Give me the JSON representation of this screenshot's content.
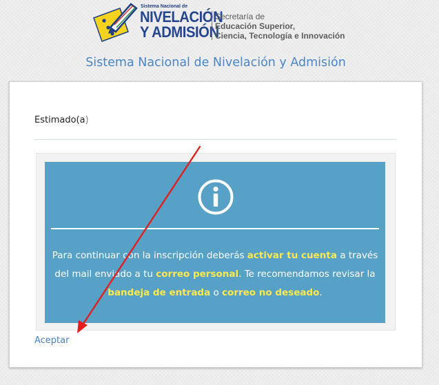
{
  "header": {
    "logo": {
      "small_text": "Sistema Nacional de",
      "big_line1": "NIVELACIÓN",
      "big_line2": "Y ADMISIÓN",
      "secretaria_line1": "Secretaría de",
      "secretaria_line2": "Educación Superior,",
      "secretaria_line3": "Ciencia, Tecnología e Innovación"
    },
    "title": "Sistema Nacional de Nivelación y Admisión"
  },
  "card": {
    "greeting_label": "Estimado(a):",
    "notice": {
      "icon": "info-icon",
      "segments": {
        "t1": "Para continuar con la inscripción deberás ",
        "h1": "activar tu cuenta",
        "t2": " a través del mail enviado a tu ",
        "h2": "correo personal",
        "t3": ". Te recomendamos revisar la ",
        "h3": "bandeja de entrada",
        "t4": " o ",
        "h4": "correo no deseado",
        "t5": "."
      }
    },
    "accept_label": "Aceptar"
  },
  "colors": {
    "title_blue": "#4a86c5",
    "logo_blue": "#24468f",
    "notice_bg": "#58a1c6",
    "highlight_yellow": "#ffe94d",
    "link_blue": "#4a7fbe",
    "arrow_red": "#e02020"
  }
}
